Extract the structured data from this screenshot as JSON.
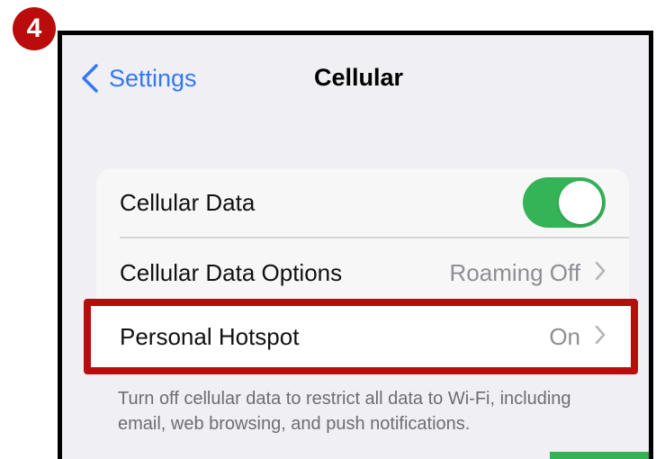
{
  "step_badge": "4",
  "nav": {
    "back_label": "Settings",
    "title": "Cellular"
  },
  "rows": {
    "cellular_data": {
      "label": "Cellular Data",
      "toggle_state": "on",
      "toggle_color": "#35b357"
    },
    "cellular_data_options": {
      "label": "Cellular Data Options",
      "value": "Roaming Off"
    },
    "personal_hotspot": {
      "label": "Personal Hotspot",
      "value": "On"
    }
  },
  "footer_note": "Turn off cellular data to restrict all data to Wi-Fi, including email, web browsing, and push notifications.",
  "colors": {
    "accent": "#3478f6",
    "highlight": "#b80d0d",
    "badge": "#ba0c0c",
    "background": "#efeff4"
  },
  "icons": {
    "back": "chevron-left-icon",
    "disclosure": "chevron-right-icon"
  }
}
